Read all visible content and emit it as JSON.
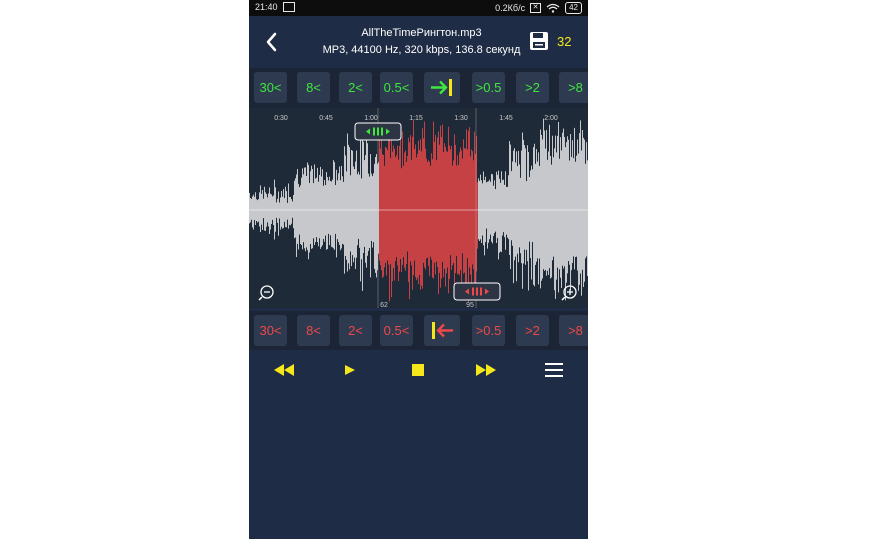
{
  "status": {
    "time": "21:40",
    "speed": "0.2Кб/с",
    "battery": "42"
  },
  "header": {
    "title": "AllTheTimeРингтон.mp3",
    "subtitle": "MP3, 44100 Hz, 320 kbps, 136.8 секунд",
    "save_count": "32"
  },
  "start_controls": [
    "30<",
    "8<",
    "2<",
    "0.5<",
    ">0.5",
    ">2",
    ">8"
  ],
  "end_controls": [
    "30<",
    "8<",
    "2<",
    "0.5<",
    ">0.5",
    ">2",
    ">8"
  ],
  "timeline": {
    "ticks": [
      "0:30",
      "0:45",
      "1:00",
      "1:15",
      "1:30",
      "1:45",
      "2:00"
    ],
    "start_marker": "62",
    "end_marker": "95"
  },
  "colors": {
    "selection": "#f04848",
    "accent_yellow": "#f6e71b",
    "start_green": "#3fe63f",
    "end_red": "#f04848"
  },
  "icons": {
    "back": "chevron-left-icon",
    "save": "floppy-icon",
    "zoom_out": "zoom-out-icon",
    "zoom_in": "zoom-in-icon",
    "rewind": "rewind-icon",
    "play": "play-icon",
    "stop": "stop-icon",
    "forward": "fast-forward-icon",
    "menu": "menu-icon"
  }
}
